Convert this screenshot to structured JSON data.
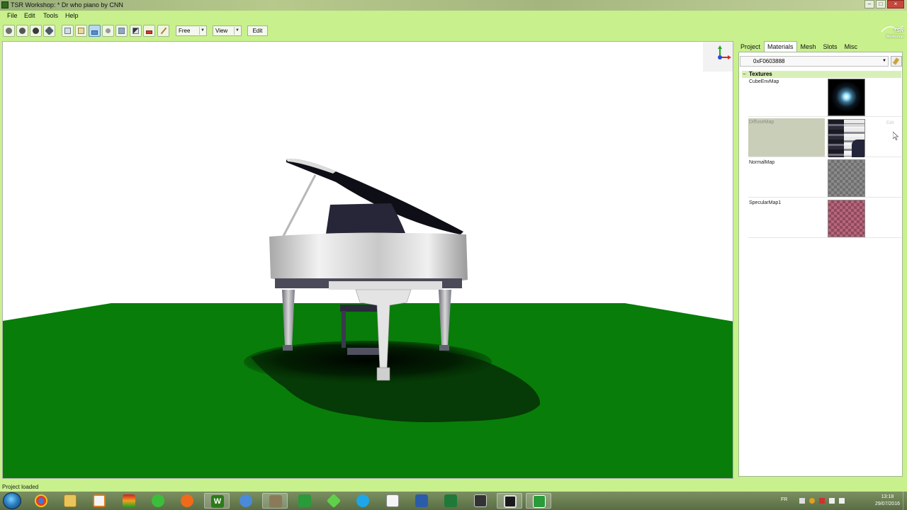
{
  "window": {
    "title": "TSR Workshop: * Dr who piano by CNN",
    "minimize": "–",
    "maximize": "□",
    "close": "×"
  },
  "menu": {
    "items": [
      {
        "label": "File"
      },
      {
        "label": "Edit"
      },
      {
        "label": "Tools"
      },
      {
        "label": "Help"
      }
    ]
  },
  "toolbar": {
    "camera_mode": "Free",
    "view_label": "View",
    "edit_label": "Edit",
    "logo_text": "TSR Workshop",
    "buttons": [
      "shade-smooth-icon",
      "shade-flat-icon",
      "shade-solid-icon",
      "shade-wire-icon",
      "bounding-box-icon",
      "bones-icon",
      "shadow-icon",
      "light-icon",
      "grid-icon",
      "texture-icon",
      "color-icon",
      "eyedropper-icon"
    ]
  },
  "panel": {
    "tabs": [
      {
        "label": "Project",
        "active": false
      },
      {
        "label": "Materials",
        "active": true
      },
      {
        "label": "Mesh",
        "active": false
      },
      {
        "label": "Slots",
        "active": false
      },
      {
        "label": "Misc",
        "active": false
      }
    ],
    "material_id": "0xF0603888",
    "textures_header": "Textures",
    "textures": [
      {
        "name": "CubeEnvMap",
        "selected": false
      },
      {
        "name": "DiffuseMap",
        "selected": true,
        "edit": "Edit"
      },
      {
        "name": "NormalMap",
        "selected": false
      },
      {
        "name": "SpecularMap1",
        "selected": false
      }
    ]
  },
  "status": {
    "text": "Project loaded"
  },
  "taskbar": {
    "apps": [
      "start-orb",
      "chrome-icon",
      "explorer-icon",
      "media-player-icon",
      "strat-icon",
      "sims-icon",
      "origin-icon",
      "tsr-workshop-icon",
      "teamspeak-icon",
      "gimp-icon",
      "camtasia-icon",
      "sims-green-icon",
      "skype-icon",
      "notepad-icon",
      "word-icon",
      "excel-icon",
      "clapperboard-icon",
      "film-icon",
      "camtasia-recorder-icon"
    ],
    "lang": "FR",
    "time": "13:18",
    "date": "29/07/2016"
  },
  "colors": {
    "chrome": "#c8f08c",
    "floor": "#087d09",
    "piano_body": "#e6e6e6",
    "piano_dark": "#1b1b2c"
  }
}
